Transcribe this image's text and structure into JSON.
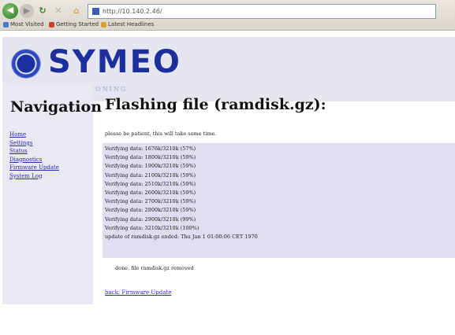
{
  "browser": {
    "url": "http://10.140.2.46/",
    "bookmarks": [
      "Most Visited",
      "Getting Started",
      "Latest Headlines"
    ]
  },
  "banner": {
    "logo_text": "SYMEO",
    "tagline": "ABSOLUTE POSITIONING"
  },
  "sidebar": {
    "title": "Navigation",
    "items": [
      "Home",
      "Settings",
      "Status",
      "Diagnostics",
      "Firmware Update",
      "System Log"
    ]
  },
  "main": {
    "title": "Flashing file (ramdisk.gz):",
    "notice": "please be patient, this will take some time.",
    "log_lines": [
      "Verifying data: 1676k/3210k (57%)",
      "Verifying data: 1800k/3210k (59%)",
      "Verifying data: 1900k/3210k (59%)",
      "Verifying data: 2100k/3210k (59%)",
      "Verifying data: 2510k/3210k (59%)",
      "Verifying data: 2600k/3210k (59%)",
      "Verifying data: 2700k/3210k (59%)",
      "Verifying data: 2800k/3210k (59%)",
      "Verifying data: 2900k/3210k (99%)",
      "Verifying data: 3210k/3210k (100%)",
      "update of ramdisk.gz ended: Thu Jan 1 01:00:06 CET 1970"
    ],
    "done_text": "done. file ramdisk.gz removed",
    "back_link": "back: Firmware Update"
  }
}
